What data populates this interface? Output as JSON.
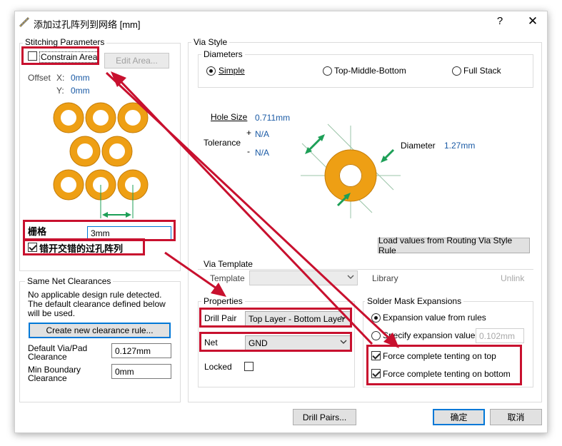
{
  "window": {
    "title": "添加过孔阵列到网络 [mm]",
    "help": "?",
    "close": "✕"
  },
  "stitching": {
    "legend": "Stitching Parameters",
    "constrain_area_label": "Constrain Area",
    "constrain_area_checked": false,
    "edit_area_button": "Edit Area...",
    "offset_label": "Offset",
    "x_label": "X:",
    "x_value": "0mm",
    "y_label": "Y:",
    "y_value": "0mm",
    "grid_label": "栅格",
    "grid_value": "3mm",
    "staggered_label": "错开交错的过孔阵列",
    "staggered_checked": true
  },
  "clearances": {
    "legend": "Same Net Clearances",
    "message_line1": "No applicable design rule detected.",
    "message_line2": "The default clearance defined below",
    "message_line3": "will be used.",
    "create_button": "Create new clearance rule...",
    "via_pad_label_1": "Default Via/Pad",
    "via_pad_label_2": "Clearance",
    "via_pad_value": "0.127mm",
    "min_boundary_label_1": "Min Boundary",
    "min_boundary_label_2": "Clearance",
    "min_boundary_value": "0mm"
  },
  "via_style": {
    "legend": "Via Style",
    "diameters_legend": "Diameters",
    "options": [
      "Simple",
      "Top-Middle-Bottom",
      "Full Stack"
    ],
    "selected": "Simple",
    "hole_size_label": "Hole Size",
    "hole_size_value": "0.711mm",
    "tolerance_label": "Tolerance",
    "tol_plus": "+",
    "tol_plus_value": "N/A",
    "tol_minus": "-",
    "tol_minus_value": "N/A",
    "diameter_label": "Diameter",
    "diameter_value": "1.27mm",
    "load_button": "Load values from Routing Via Style Rule"
  },
  "via_template": {
    "legend": "Via Template",
    "template_label": "Template",
    "template_value": "",
    "library_label": "Library",
    "unlink": "Unlink"
  },
  "properties": {
    "legend": "Properties",
    "drill_pair_label": "Drill Pair",
    "drill_pair_value": "Top Layer - Bottom Layer",
    "net_label": "Net",
    "net_value": "GND",
    "locked_label": "Locked",
    "locked_checked": false
  },
  "solder_mask": {
    "legend": "Solder Mask Expansions",
    "from_rules_label": "Expansion value from rules",
    "specify_label": "Specify expansion value",
    "specify_value": "0.102mm",
    "tent_top_label": "Force complete tenting on top",
    "tent_top_checked": true,
    "tent_bottom_label": "Force complete tenting on bottom",
    "tent_bottom_checked": true
  },
  "footer": {
    "drill_pairs_button": "Drill Pairs...",
    "ok_button": "确定",
    "cancel_button": "取消"
  },
  "colors": {
    "annotation_red": "#c8102e",
    "value_blue": "#1a5aa5",
    "via_copper": "#f0a81e",
    "dimension_green": "#1d9f57"
  }
}
